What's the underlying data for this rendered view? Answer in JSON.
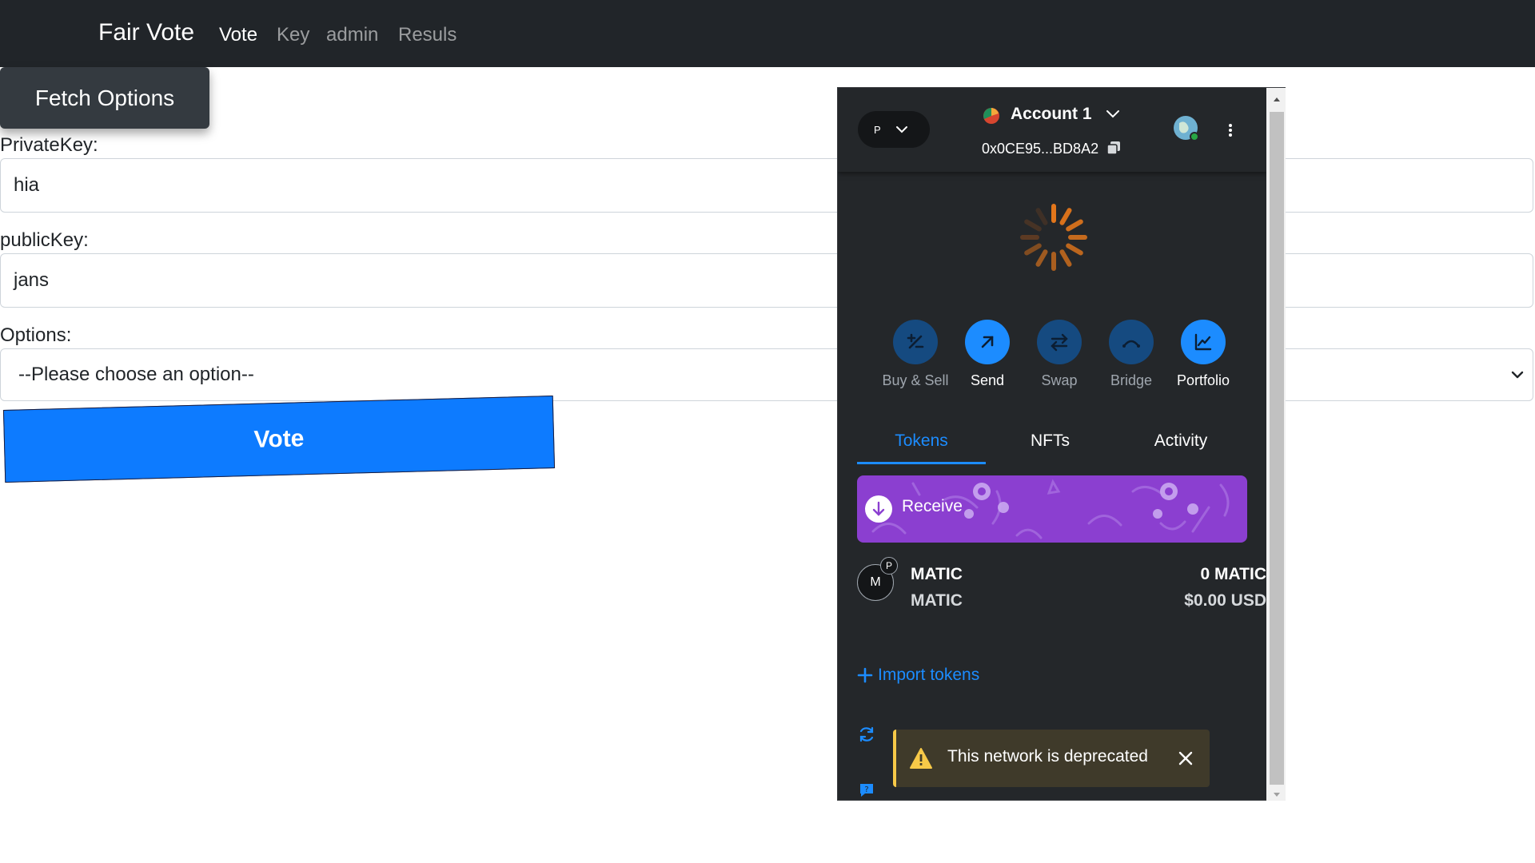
{
  "navbar": {
    "brand": "Fair Vote",
    "links": [
      "Vote",
      "Key",
      "admin",
      "Resuls"
    ],
    "active": "Vote"
  },
  "form": {
    "fetch_button": "Fetch Options",
    "private_key_label": "PrivateKey:",
    "private_key_value": "hia",
    "public_key_label": "publicKey:",
    "public_key_value": "jans",
    "options_label": "Options:",
    "options_selected": "--Please choose an option--",
    "vote_button": "Vote"
  },
  "wallet": {
    "network_letter": "P",
    "account_name": "Account 1",
    "account_address": "0x0CE95...BD8A2",
    "actions": [
      {
        "label": "Buy & Sell",
        "icon": "plus-minus-icon",
        "enabled": false
      },
      {
        "label": "Send",
        "icon": "arrow-up-right-icon",
        "enabled": true
      },
      {
        "label": "Swap",
        "icon": "swap-icon",
        "enabled": false
      },
      {
        "label": "Bridge",
        "icon": "bridge-icon",
        "enabled": false
      },
      {
        "label": "Portfolio",
        "icon": "chart-line-icon",
        "enabled": true
      }
    ],
    "tabs": [
      "Tokens",
      "NFTs",
      "Activity"
    ],
    "active_tab": "Tokens",
    "receive_label": "Receive",
    "token": {
      "icon_letter": "M",
      "badge_letter": "P",
      "name": "MATIC",
      "subname": "MATIC",
      "balance": "0 MATIC",
      "fiat": "$0.00 USD"
    },
    "import_tokens": "Import tokens",
    "toast": "This network is deprecated"
  },
  "colors": {
    "navbar": "#212529",
    "primary": "#0d7bff",
    "wallet_bg": "#24272a",
    "wallet_accent": "#1c8cff",
    "receive_banner": "#8b3fd0",
    "warning": "#f7c948"
  }
}
